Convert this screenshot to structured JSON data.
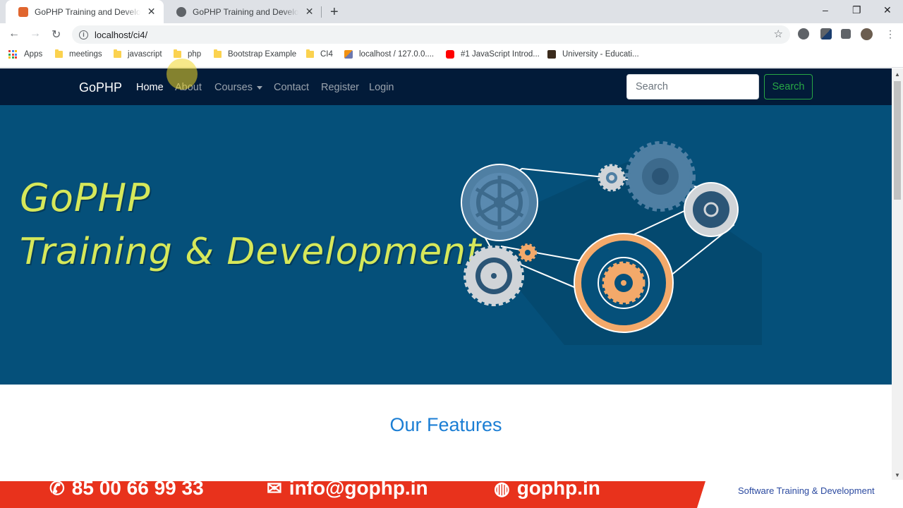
{
  "browser": {
    "tabs": [
      {
        "title": "GoPHP Training and Development",
        "active": true
      },
      {
        "title": "GoPHP Training and Development",
        "active": false
      }
    ],
    "new_tab": "+",
    "window_controls": {
      "minimize": "–",
      "restore": "❐",
      "close": "✕"
    },
    "url": "localhost/ci4/",
    "bookmarks": [
      {
        "label": "Apps",
        "icon": "apps-grid-icon"
      },
      {
        "label": "meetings",
        "icon": "folder-icon"
      },
      {
        "label": "javascript",
        "icon": "folder-icon"
      },
      {
        "label": "php",
        "icon": "folder-icon"
      },
      {
        "label": "Bootstrap Example",
        "icon": "folder-icon"
      },
      {
        "label": "CI4",
        "icon": "folder-icon"
      },
      {
        "label": "localhost / 127.0.0....",
        "icon": "phpmyadmin-icon"
      },
      {
        "label": "#1 JavaScript Introd...",
        "icon": "youtube-icon"
      },
      {
        "label": "University - Educati...",
        "icon": "site-icon"
      }
    ]
  },
  "site": {
    "brand": "GoPHP",
    "nav": [
      {
        "label": "Home",
        "active": true
      },
      {
        "label": "About",
        "active": false
      },
      {
        "label": "Courses",
        "active": false,
        "dropdown": true
      },
      {
        "label": "Contact",
        "active": false
      },
      {
        "label": "Register",
        "active": false
      },
      {
        "label": "Login",
        "active": false
      }
    ],
    "search_placeholder": "Search",
    "search_button": "Search",
    "hero_line1": "GoPHP",
    "hero_line2": "Training & Development",
    "features_heading": "Our Features"
  },
  "promo_banner": {
    "phone": "85 00 66 99 33",
    "email": "info@gophp.in",
    "website": "gophp.in",
    "tagline": "Software Training & Development"
  },
  "colors": {
    "navbar": "#021b39",
    "hero": "#05507a",
    "hero_text": "#d6e85a",
    "accent_green": "#28a745",
    "features_heading": "#1b7ed4",
    "promo_red": "#e8321c"
  }
}
